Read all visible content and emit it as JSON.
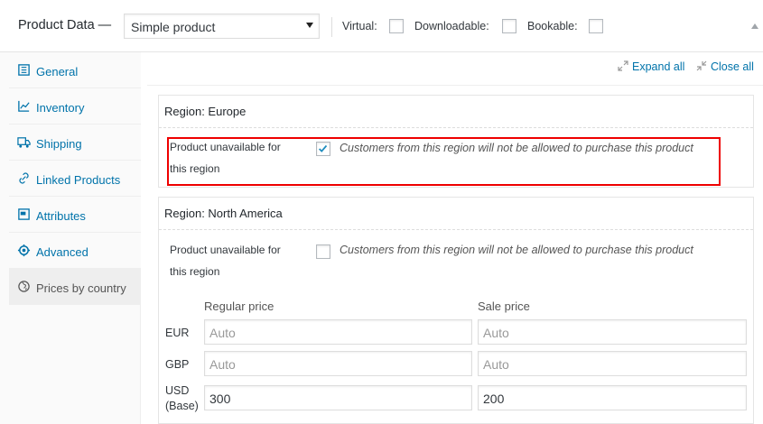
{
  "header": {
    "title": "Product Data —",
    "product_type": "Simple product",
    "options": [
      {
        "label": "Virtual:",
        "checked": false
      },
      {
        "label": "Downloadable:",
        "checked": false
      },
      {
        "label": "Bookable:",
        "checked": false
      }
    ]
  },
  "sidebar": {
    "items": [
      {
        "label": "General",
        "icon": "general-icon"
      },
      {
        "label": "Inventory",
        "icon": "inventory-icon"
      },
      {
        "label": "Shipping",
        "icon": "truck-icon"
      },
      {
        "label": "Linked Products",
        "icon": "link-icon"
      },
      {
        "label": "Attributes",
        "icon": "attributes-icon"
      },
      {
        "label": "Advanced",
        "icon": "gear-icon"
      },
      {
        "label": "Prices by country",
        "icon": "globe-icon",
        "active": true
      }
    ]
  },
  "toolbar": {
    "expand_all": "Expand all",
    "close_all": "Close all"
  },
  "regions": [
    {
      "title": "Region:  Europe",
      "unavailable_label_line1": "Product unavailable for",
      "unavailable_label_line2": "this region",
      "unavailable_checked": true,
      "unavailable_text": "Customers from this region will not be allowed to purchase this product"
    },
    {
      "title": "Region:  North America",
      "unavailable_label_line1": "Product unavailable for",
      "unavailable_label_line2": "this region",
      "unavailable_checked": false,
      "unavailable_text": "Customers from this region will not be allowed to purchase this product",
      "regular_price_header": "Regular price",
      "sale_price_header": "Sale price",
      "rows": [
        {
          "currency": "EUR",
          "currency2": "",
          "regular": "",
          "regular_placeholder": "Auto",
          "sale": "",
          "sale_placeholder": "Auto"
        },
        {
          "currency": "GBP",
          "currency2": "",
          "regular": "",
          "regular_placeholder": "Auto",
          "sale": "",
          "sale_placeholder": "Auto"
        },
        {
          "currency": "USD",
          "currency2": "(Base)",
          "regular": "300",
          "regular_placeholder": "",
          "sale": "200",
          "sale_placeholder": ""
        }
      ]
    }
  ],
  "colors": {
    "accent": "#0073aa",
    "highlight": "#ee0000"
  }
}
